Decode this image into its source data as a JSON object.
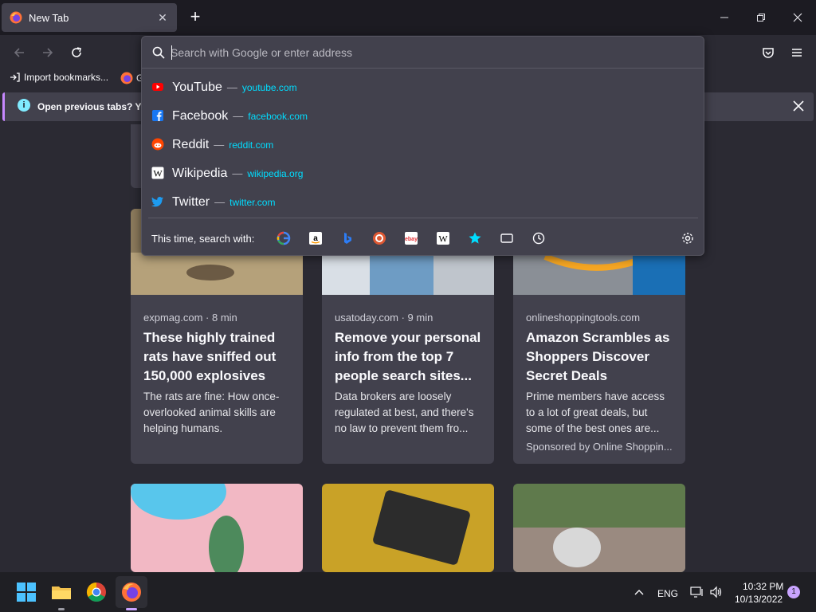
{
  "tab": {
    "title": "New Tab"
  },
  "bookmarks": {
    "import_label": "Import bookmarks...",
    "second_label": "G"
  },
  "infobar": {
    "text": "Open previous tabs? You"
  },
  "urlbar": {
    "placeholder": "Search with Google or enter address",
    "suggestions": [
      {
        "name": "YouTube",
        "sep": "—",
        "url": "youtube.com"
      },
      {
        "name": "Facebook",
        "sep": "—",
        "url": "facebook.com"
      },
      {
        "name": "Reddit",
        "sep": "—",
        "url": "reddit.com"
      },
      {
        "name": "Wikipedia",
        "sep": "—",
        "url": "wikipedia.org"
      },
      {
        "name": "Twitter",
        "sep": "—",
        "url": "twitter.com"
      }
    ],
    "oneoff_label": "This time, search with:",
    "engines": [
      "google-icon",
      "amazon-icon",
      "bing-icon",
      "duckduckgo-icon",
      "ebay-icon",
      "wikipedia-icon",
      "bookmarks-star-icon",
      "tabs-icon",
      "history-icon"
    ]
  },
  "cards": [
    {
      "source": "expmag.com · 8 min",
      "title": "These highly trained rats have sniffed out 150,000 explosives",
      "desc": "The rats are fine: How once-overlooked animal skills are helping humans."
    },
    {
      "source": "usatoday.com · 9 min",
      "title": "Remove your personal info from the top 7 people search sites...",
      "desc": "Data brokers are loosely regulated at best, and there's no law to prevent them fro..."
    },
    {
      "source": "onlineshoppingtools.com",
      "title": "Amazon Scrambles as Shoppers Discover Secret Deals",
      "desc": "Prime members have access to a lot of great deals, but some of the best ones are...",
      "sponsor": "Sponsored by Online Shoppin..."
    }
  ],
  "taskbar": {
    "lang": "ENG",
    "time": "10:32 PM",
    "date": "10/13/2022",
    "badge": "1"
  },
  "colors": {
    "accent": "#00ddff",
    "bg": "#2b2a33",
    "panel": "#42414d"
  }
}
